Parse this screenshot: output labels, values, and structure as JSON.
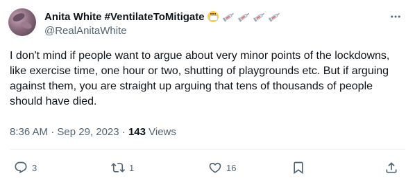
{
  "author": {
    "display_name": "Anita White #VentilateToMitigate",
    "handle": "@RealAnitaWhite"
  },
  "tweet": {
    "text": "I don't mind if people want to argue about very minor points of the lockdowns, like exercise time, one hour or two, shutting of playgrounds etc. But if arguing against them, you are straight up arguing that tens of thousands of people should have died.",
    "timestamp": "8:36 AM · Sep 29, 2023 · ",
    "views_count": "143",
    "views_label": " Views"
  },
  "actions": {
    "reply_count": "3",
    "retweet_count": "1",
    "like_count": "16"
  },
  "icons": {
    "name_emojis": [
      "face-with-medical-mask-icon",
      "syringe-icon",
      "syringe-icon",
      "syringe-icon",
      "syringe-icon"
    ],
    "more": "more-dots-icon",
    "reply": "reply-icon",
    "retweet": "retweet-icon",
    "like": "heart-icon",
    "bookmark": "bookmark-icon",
    "share": "share-icon"
  },
  "colors": {
    "text_primary": "#0f1419",
    "text_secondary": "#536471",
    "divider": "#eff3f4"
  }
}
